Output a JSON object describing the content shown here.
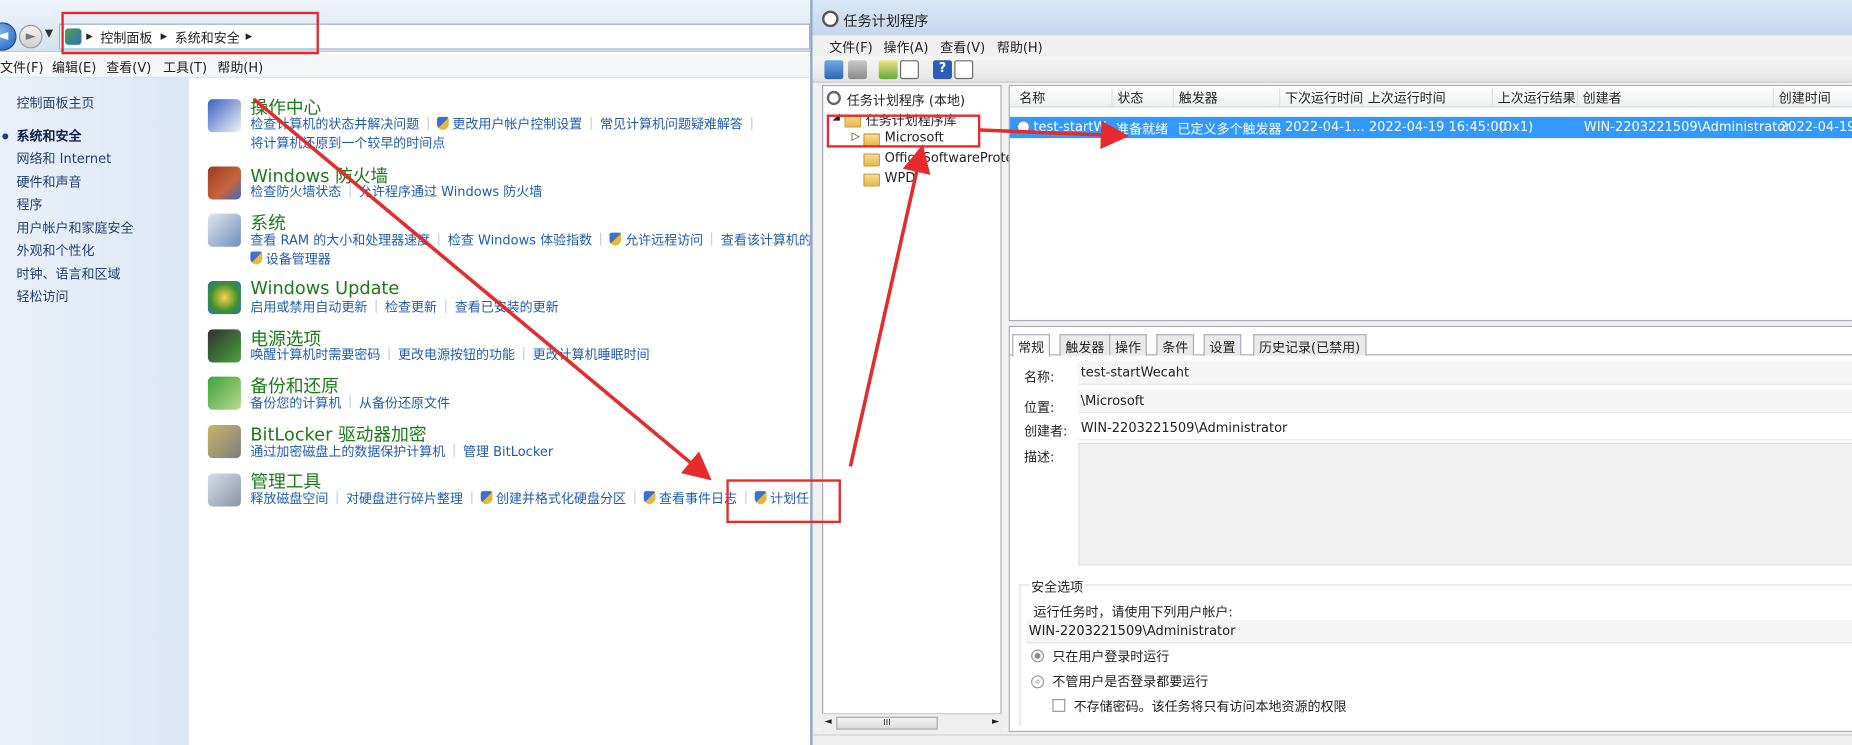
{
  "cp": {
    "path": [
      "控制面板",
      "系统和安全"
    ],
    "menu": [
      "文件(F)",
      "编辑(E)",
      "查看(V)",
      "工具(T)",
      "帮助(H)"
    ],
    "side": [
      "控制面板主页",
      "系统和安全",
      "网络和 Internet",
      "硬件和声音",
      "程序",
      "用户帐户和家庭安全",
      "外观和个性化",
      "时钟、语言和区域",
      "轻松访问"
    ],
    "categories": [
      {
        "title": "操作中心",
        "links": [
          "检查计算机的状态并解决问题",
          "更改用户帐户控制设置",
          "常见计算机问题疑难解答"
        ],
        "links2": [
          "将计算机还原到一个较早的时间点"
        ]
      },
      {
        "title": "Windows 防火墙",
        "links": [
          "检查防火墙状态",
          "允许程序通过 Windows 防火墙"
        ]
      },
      {
        "title": "系统",
        "links": [
          "查看 RAM 的大小和处理器速度",
          "检查 Windows 体验指数",
          "允许远程访问",
          "查看该计算机的名称"
        ],
        "links2": [
          "设备管理器"
        ]
      },
      {
        "title": "Windows Update",
        "links": [
          "启用或禁用自动更新",
          "检查更新",
          "查看已安装的更新"
        ]
      },
      {
        "title": "电源选项",
        "links": [
          "唤醒计算机时需要密码",
          "更改电源按钮的功能",
          "更改计算机睡眠时间"
        ]
      },
      {
        "title": "备份和还原",
        "links": [
          "备份您的计算机",
          "从备份还原文件"
        ]
      },
      {
        "title": "BitLocker 驱动器加密",
        "links": [
          "通过加密磁盘上的数据保护计算机",
          "管理 BitLocker"
        ]
      },
      {
        "title": "管理工具",
        "links": [
          "释放磁盘空间",
          "对硬盘进行碎片整理",
          "创建并格式化硬盘分区",
          "查看事件日志",
          "计划任务"
        ]
      }
    ]
  },
  "ts": {
    "title": "任务计划程序",
    "menu": [
      "文件(F)",
      "操作(A)",
      "查看(V)",
      "帮助(H)"
    ],
    "tree": {
      "root": "任务计划程序 (本地)",
      "lib": "任务计划程序库",
      "microsoft": "Microsoft",
      "office": "OfficeSoftwareProte",
      "wpd": "WPD",
      "scroll": "III"
    },
    "columns": [
      "名称",
      "状态",
      "触发器",
      "下次运行时间",
      "上次运行时间",
      "上次运行结果",
      "创建者",
      "创建时间"
    ],
    "row": [
      "test-startW...",
      "准备就绪",
      "已定义多个触发器",
      "2022-04-1...",
      "2022-04-19 16:45:00",
      "(0x1)",
      "WIN-2203221509\\Administrator",
      "2022-04-19"
    ],
    "tabs": [
      "常规",
      "触发器",
      "操作",
      "条件",
      "设置",
      "历史记录(已禁用)"
    ],
    "general": {
      "name_label": "名称:",
      "name": "test-startWecaht",
      "loc_label": "位置:",
      "loc": "\\Microsoft",
      "author_label": "创建者:",
      "author": "WIN-2203221509\\Administrator",
      "desc_label": "描述:",
      "security_title": "安全选项",
      "run_as_text": "运行任务时，请使用下列用户帐户:",
      "run_as_user": "WIN-2203221509\\Administrator",
      "opt1": "只在用户登录时运行",
      "opt2": "不管用户是否登录都要运行",
      "opt3": "不存储密码。该任务将只有访问本地资源的权限"
    }
  },
  "colors": {
    "annotation": "#e52b2b",
    "link": "#1e5cb3",
    "category": "#1a7c16",
    "selection": "#3399ff"
  }
}
